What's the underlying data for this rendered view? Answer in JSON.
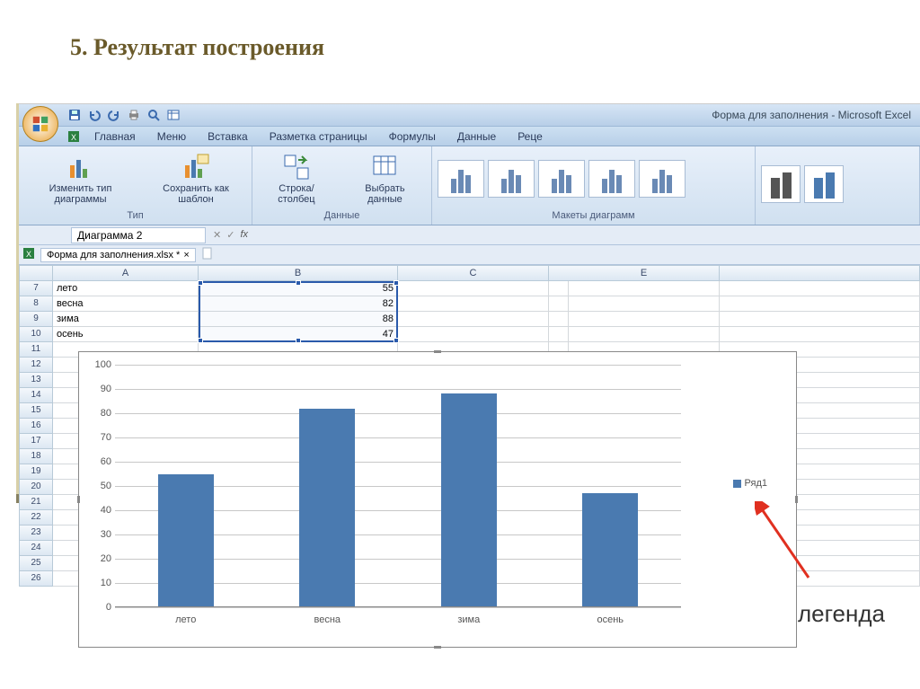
{
  "slide": {
    "title": "5. Результат построения",
    "annotation": "легенда"
  },
  "window": {
    "title": "Форма для заполнения  -  Microsoft Excel"
  },
  "ribbon_tabs": [
    "Главная",
    "Меню",
    "Вставка",
    "Разметка страницы",
    "Формулы",
    "Данные",
    "Реце"
  ],
  "ribbon": {
    "type_group": {
      "label": "Тип",
      "btn_change": "Изменить тип диаграммы",
      "btn_save": "Сохранить как шаблон"
    },
    "data_group": {
      "label": "Данные",
      "btn_rowcol": "Строка/столбец",
      "btn_select": "Выбрать данные"
    },
    "layouts_group": {
      "label": "Макеты диаграмм"
    }
  },
  "name_box": "Диаграмма 2",
  "doc_tab": "Форма для заполнения.xlsx *",
  "columns": [
    "A",
    "B",
    "C",
    "E"
  ],
  "data_rows": [
    {
      "n": 7,
      "A": "лето",
      "B": 55
    },
    {
      "n": 8,
      "A": "весна",
      "B": 82
    },
    {
      "n": 9,
      "A": "зима",
      "B": 88
    },
    {
      "n": 10,
      "A": "осень",
      "B": 47
    }
  ],
  "chart_data": {
    "type": "bar",
    "categories": [
      "лето",
      "весна",
      "зима",
      "осень"
    ],
    "values": [
      55,
      82,
      88,
      47
    ],
    "series": [
      {
        "name": "Ряд1",
        "values": [
          55,
          82,
          88,
          47
        ]
      }
    ],
    "title": "",
    "xlabel": "",
    "ylabel": "",
    "ylim": [
      0,
      100
    ],
    "y_ticks": [
      0,
      10,
      20,
      30,
      40,
      50,
      60,
      70,
      80,
      90,
      100
    ],
    "legend": "Ряд1"
  }
}
